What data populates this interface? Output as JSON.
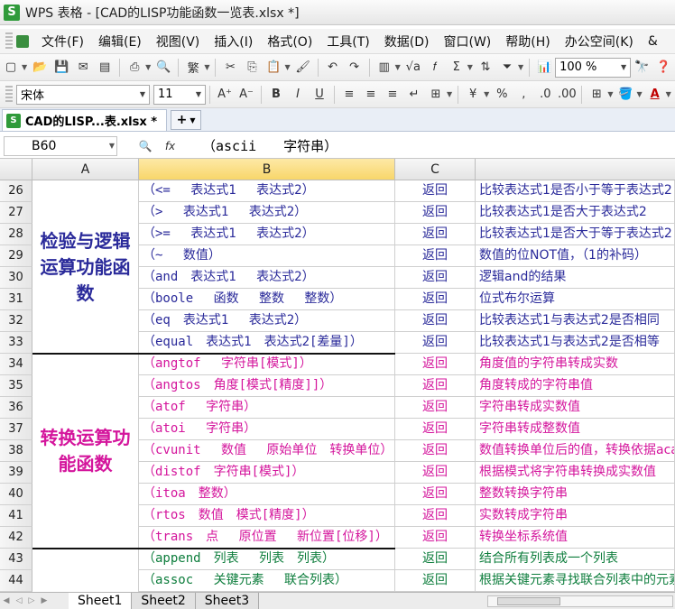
{
  "window": {
    "title": "WPS 表格 - [CAD的LISP功能函数一览表.xlsx *]",
    "logo": "S"
  },
  "menubar": {
    "items": [
      "文件(F)",
      "编辑(E)",
      "视图(V)",
      "插入(I)",
      "格式(O)",
      "工具(T)",
      "数据(D)",
      "窗口(W)",
      "帮助(H)",
      "办公空间(K)",
      "&"
    ]
  },
  "toolbar": {
    "zoom": "100 %",
    "font_name": "宋体",
    "font_size": "11"
  },
  "tabs": {
    "document": "CAD的LISP...表.xlsx *",
    "new_tab": "+"
  },
  "formula_bar": {
    "name_box": "B60",
    "formula": "（ascii　　字符串）"
  },
  "columns": [
    "A",
    "B",
    "C"
  ],
  "groups": [
    {
      "label": "检验与逻辑运算功能函数",
      "color": "#2a2a9a"
    },
    {
      "label": "转换运算功能函数",
      "color": "#d4159c"
    }
  ],
  "rows": [
    {
      "n": "26",
      "b": "（<=　 表达式1　 表达式2）",
      "c": "返回",
      "d": "比较表达式1是否小于等于表达式2",
      "style": "blue"
    },
    {
      "n": "27",
      "b": "（>　 表达式1　 表达式2）",
      "c": "返回",
      "d": "比较表达式1是否大于表达式2",
      "style": "blue"
    },
    {
      "n": "28",
      "b": "（>=　 表达式1　 表达式2）",
      "c": "返回",
      "d": "比较表达式1是否大于等于表达式2",
      "style": "blue"
    },
    {
      "n": "29",
      "b": "（~　 数值）",
      "c": "返回",
      "d": "数值的位NOT值，（1的补码）",
      "style": "blue"
    },
    {
      "n": "30",
      "b": "（and　表达式1　 表达式2）",
      "c": "返回",
      "d": "逻辑and的结果",
      "style": "blue"
    },
    {
      "n": "31",
      "b": "（boole　 函数　 整数　 整数）",
      "c": "返回",
      "d": "位式布尔运算",
      "style": "blue"
    },
    {
      "n": "32",
      "b": "（eq　表达式1　 表达式2）",
      "c": "返回",
      "d": "比较表达式1与表达式2是否相同",
      "style": "blue"
    },
    {
      "n": "33",
      "b": "（equal　表达式1　表达式2[差量]）",
      "c": "返回",
      "d": "比较表达式1与表达式2是否相等",
      "style": "blue"
    },
    {
      "n": "34",
      "b": "（angtof　 字符串[模式]）",
      "c": "返回",
      "d": "角度值的字符串转成实数",
      "style": "pink"
    },
    {
      "n": "35",
      "b": "（angtos　角度[模式[精度]]）",
      "c": "返回",
      "d": "角度转成的字符串值",
      "style": "pink"
    },
    {
      "n": "36",
      "b": "（atof　 字符串）",
      "c": "返回",
      "d": "字符串转成实数值",
      "style": "pink"
    },
    {
      "n": "37",
      "b": "（atoi　 字符串）",
      "c": "返回",
      "d": "字符串转成整数值",
      "style": "pink"
    },
    {
      "n": "38",
      "b": "（cvunit　 数值　 原始单位　转换单位）",
      "c": "返回",
      "d": "数值转换单位后的值，转换依据acad.unt",
      "style": "pink"
    },
    {
      "n": "39",
      "b": "（distof　字符串[模式]）",
      "c": "返回",
      "d": "根据模式将字符串转换成实数值",
      "style": "pink"
    },
    {
      "n": "40",
      "b": "（itoa　整数）",
      "c": "返回",
      "d": "整数转换字符串",
      "style": "pink"
    },
    {
      "n": "41",
      "b": "（rtos　数值　模式[精度]）",
      "c": "返回",
      "d": "实数转成字符串",
      "style": "pink"
    },
    {
      "n": "42",
      "b": "（trans　点　 原位置　 新位置[位移]）",
      "c": "返回",
      "d": "转换坐标系统值",
      "style": "pink"
    },
    {
      "n": "43",
      "b": "（append　列表　 列表　列表）",
      "c": "返回",
      "d": "结合所有列表成一个列表",
      "style": "green"
    },
    {
      "n": "44",
      "b": "（assoc　 关键元素　 联合列表）",
      "c": "返回",
      "d": "根据关键元素寻找联合列表中的元素",
      "style": "green"
    }
  ],
  "sheets": [
    "Sheet1",
    "Sheet2",
    "Sheet3"
  ]
}
